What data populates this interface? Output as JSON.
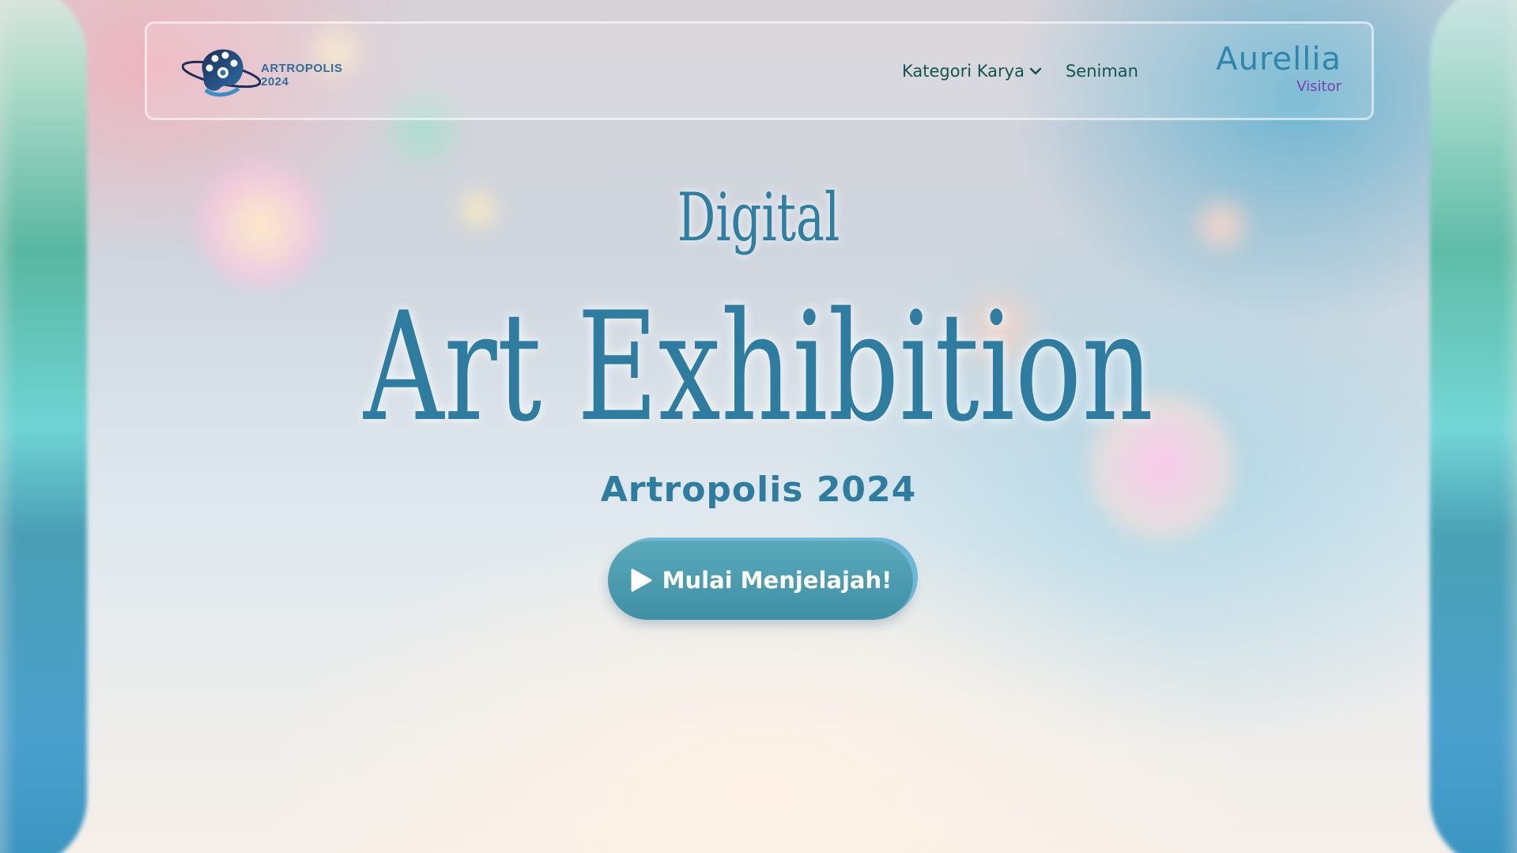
{
  "brand": {
    "logo_line1": "ARTROPOLIS",
    "logo_line2": "2024",
    "logo_icon": "planet-palette-icon"
  },
  "nav": {
    "items": [
      {
        "label": "Kategori Karya",
        "has_dropdown": true,
        "icon": "chevron-down-icon"
      },
      {
        "label": "Seniman",
        "has_dropdown": false
      }
    ]
  },
  "user": {
    "name": "Aurellia",
    "role": "Visitor"
  },
  "hero": {
    "kicker": "Digital",
    "title": "Art Exhibition",
    "subtitle": "Artropolis 2024",
    "cta_label": "Mulai Menjelajah!",
    "cta_icon": "play-icon"
  },
  "colors": {
    "primary": "#2e7ca0",
    "nav_text": "#12544f",
    "role_text": "#7b3fb0",
    "cta_bg": "#4a9bb0"
  }
}
